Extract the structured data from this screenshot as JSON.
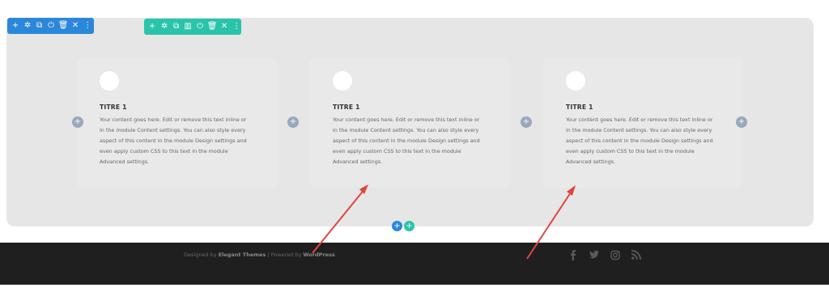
{
  "toolbars": {
    "section": {
      "icons": [
        "add-icon",
        "gear-icon",
        "duplicate-icon",
        "power-icon",
        "trash-icon",
        "close-icon",
        "more-icon"
      ],
      "glyphs": [
        "+",
        "✲",
        "⧉",
        "⏻",
        "🗑",
        "✕",
        "⋮"
      ]
    },
    "row": {
      "icons": [
        "add-icon",
        "gear-icon",
        "duplicate-icon",
        "columns-icon",
        "power-icon",
        "trash-icon",
        "close-icon",
        "more-icon"
      ],
      "glyphs": [
        "+",
        "✲",
        "⧉",
        "▥",
        "⏻",
        "🗑",
        "✕",
        "⋮"
      ]
    }
  },
  "blurbs": [
    {
      "title": "TITRE 1",
      "body": "Your content goes here. Edit or remove this text inline or in the module Content settings. You can also style every aspect of this content in the module Design settings and even apply custom CSS to this text in the module Advanced settings."
    },
    {
      "title": "TITRE 1",
      "body": "Your content goes here. Edit or remove this text inline or in the module Content settings. You can also style every aspect of this content in the module Design settings and even apply custom CSS to this text in the module Advanced settings."
    },
    {
      "title": "TITRE 1",
      "body": "Your content goes here. Edit or remove this text inline or in the module Content settings. You can also style every aspect of this content in the module Design settings and even apply custom CSS to this text in the module Advanced settings."
    }
  ],
  "add_glyph": "+",
  "footer": {
    "designed_by": "Designed by",
    "elegant_themes": "Elegant Themes",
    "separator": "| Powered by",
    "wordpress": "WordPress",
    "social": [
      "facebook-icon",
      "twitter-icon",
      "instagram-icon",
      "rss-icon"
    ]
  },
  "colors": {
    "section_toolbar": "#2b87da",
    "row_toolbar": "#29c4a9",
    "annotation_arrow": "#e0453c",
    "footer_bg": "#1f1f1f"
  }
}
